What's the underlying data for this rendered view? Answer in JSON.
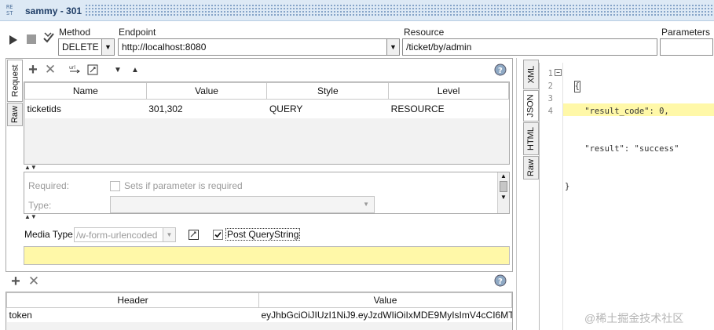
{
  "window": {
    "logo": "RE\nST",
    "title": "sammy - 301"
  },
  "toolbar": {
    "method_label": "Method",
    "method_value": "DELETE",
    "endpoint_label": "Endpoint",
    "endpoint_value": "http://localhost:8080",
    "resource_label": "Resource",
    "resource_value": "/ticket/by/admin",
    "parameters_label": "Parameters"
  },
  "left_tabs": [
    "Request",
    "Raw"
  ],
  "params_table": {
    "headers": [
      "Name",
      "Value",
      "Style",
      "Level"
    ],
    "rows": [
      {
        "name": "ticketids",
        "value": "301,302",
        "style": "QUERY",
        "level": "RESOURCE"
      }
    ]
  },
  "param_details": {
    "required_label": "Required:",
    "required_checkbox_label": "Sets if parameter is required",
    "type_label": "Type:"
  },
  "media": {
    "label": "Media Type",
    "value": "/w-form-urlencoded",
    "post_querystring_label": "Post QueryString",
    "post_querystring_checked": true
  },
  "headers_table": {
    "headers": [
      "Header",
      "Value"
    ],
    "rows": [
      {
        "header": "token",
        "value": "eyJhbGciOiJIUzI1NiJ9.eyJzdWIiOiIxMDE9MyIsImV4cCI6MT..."
      }
    ]
  },
  "right_tabs": [
    "XML",
    "JSON",
    "HTML",
    "Raw"
  ],
  "response": {
    "line_numbers": [
      "1",
      "2",
      "3",
      "4"
    ],
    "lines": [
      "{",
      "    \"result_code\": 0,",
      "    \"result\": \"success\"",
      "}"
    ]
  },
  "watermark": "@稀土掘金技术社区",
  "colors": {
    "highlight": "#fff8a8",
    "titlebar": "#dde9f5"
  }
}
